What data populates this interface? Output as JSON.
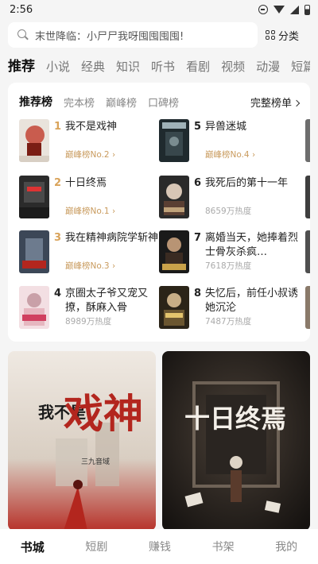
{
  "status": {
    "time": "2:56"
  },
  "search": {
    "placeholder": "末世降临：小尸尸我呀囤囤囤囤!",
    "category_label": "分类"
  },
  "tabs": [
    "推荐",
    "小说",
    "经典",
    "知识",
    "听书",
    "看剧",
    "视频",
    "动漫",
    "短篇"
  ],
  "ranking": {
    "tabs": [
      "推荐榜",
      "完本榜",
      "巅峰榜",
      "口碑榜"
    ],
    "full_list_label": "完整榜单",
    "books": [
      {
        "rank": "1",
        "title": "我不是戏神",
        "sub": "巅峰榜No.2",
        "sub_arrow": true
      },
      {
        "rank": "2",
        "title": "十日终焉",
        "sub": "巅峰榜No.1",
        "sub_arrow": true
      },
      {
        "rank": "3",
        "title": "我在精神病院学斩神",
        "sub": "巅峰榜No.3",
        "sub_arrow": true
      },
      {
        "rank": "4",
        "title": "京圈太子爷又宠又撩，酥麻入骨",
        "sub": "8989万热度"
      },
      {
        "rank": "5",
        "title": "异兽迷城",
        "sub": "巅峰榜No.4",
        "sub_arrow": true
      },
      {
        "rank": "6",
        "title": "我死后的第十一年",
        "sub": "8659万热度"
      },
      {
        "rank": "7",
        "title": "离婚当天，她捧着烈士骨灰杀疯…",
        "sub": "7618万热度"
      },
      {
        "rank": "8",
        "title": "失忆后，前任小叔诱她沉沦",
        "sub": "7487万热度"
      }
    ]
  },
  "features": [
    {
      "cover_text_1": "我不是",
      "cover_text_2": "戏神",
      "cover_publisher": "三九音域",
      "cover_tagline": ""
    },
    {
      "cover_text_1": "十日终焉",
      "cover_text_2": ""
    }
  ],
  "bottom_nav": [
    "书城",
    "短剧",
    "赚钱",
    "书架",
    "我的"
  ],
  "colors": {
    "accent_gold": "#d9a35a",
    "background": "#f5f5f5"
  }
}
